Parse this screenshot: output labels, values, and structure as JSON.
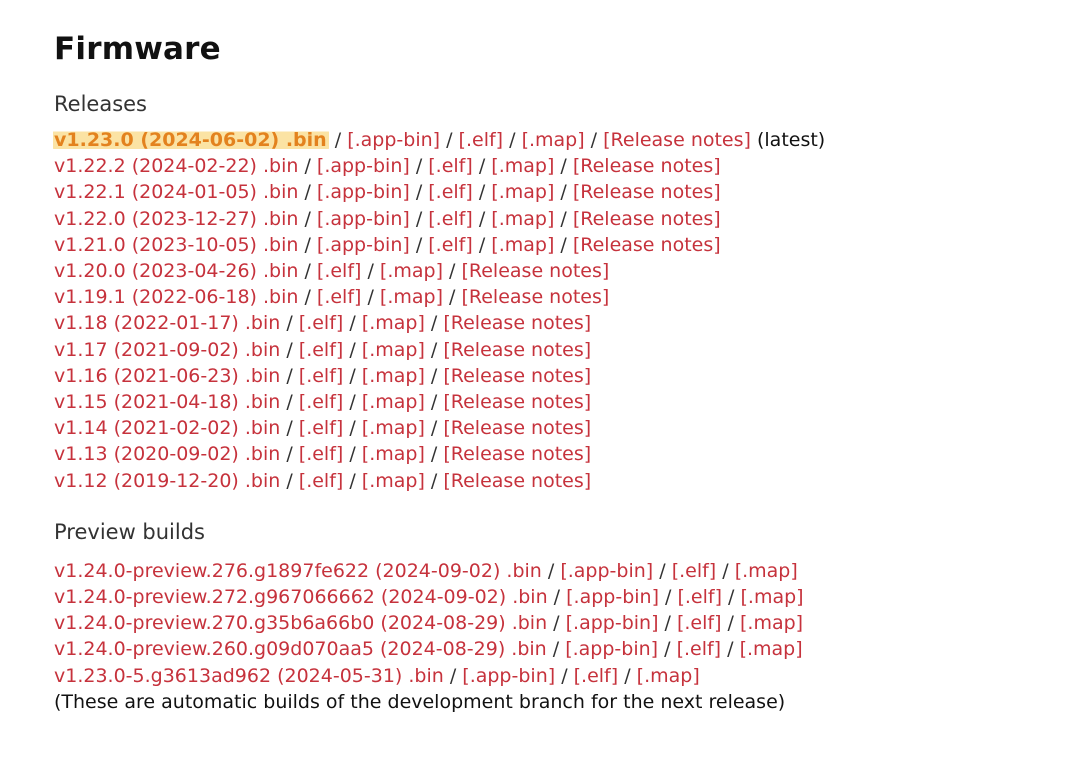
{
  "title": "Firmware",
  "releases_heading": "Releases",
  "releases": [
    {
      "bin": "v1.23.0 (2024-06-02) .bin",
      "app_bin": "[.app-bin]",
      "elf": "[.elf]",
      "map": "[.map]",
      "notes": "[Release notes]",
      "tag": "(latest)"
    },
    {
      "bin": "v1.22.2 (2024-02-22) .bin",
      "app_bin": "[.app-bin]",
      "elf": "[.elf]",
      "map": "[.map]",
      "notes": "[Release notes]"
    },
    {
      "bin": "v1.22.1 (2024-01-05) .bin",
      "app_bin": "[.app-bin]",
      "elf": "[.elf]",
      "map": "[.map]",
      "notes": "[Release notes]"
    },
    {
      "bin": "v1.22.0 (2023-12-27) .bin",
      "app_bin": "[.app-bin]",
      "elf": "[.elf]",
      "map": "[.map]",
      "notes": "[Release notes]"
    },
    {
      "bin": "v1.21.0 (2023-10-05) .bin",
      "app_bin": "[.app-bin]",
      "elf": "[.elf]",
      "map": "[.map]",
      "notes": "[Release notes]"
    },
    {
      "bin": "v1.20.0 (2023-04-26) .bin",
      "elf": "[.elf]",
      "map": "[.map]",
      "notes": "[Release notes]"
    },
    {
      "bin": "v1.19.1 (2022-06-18) .bin",
      "elf": "[.elf]",
      "map": "[.map]",
      "notes": "[Release notes]"
    },
    {
      "bin": "v1.18 (2022-01-17) .bin",
      "elf": "[.elf]",
      "map": "[.map]",
      "notes": "[Release notes]"
    },
    {
      "bin": "v1.17 (2021-09-02) .bin",
      "elf": "[.elf]",
      "map": "[.map]",
      "notes": "[Release notes]"
    },
    {
      "bin": "v1.16 (2021-06-23) .bin",
      "elf": "[.elf]",
      "map": "[.map]",
      "notes": "[Release notes]"
    },
    {
      "bin": "v1.15 (2021-04-18) .bin",
      "elf": "[.elf]",
      "map": "[.map]",
      "notes": "[Release notes]"
    },
    {
      "bin": "v1.14 (2021-02-02) .bin",
      "elf": "[.elf]",
      "map": "[.map]",
      "notes": "[Release notes]"
    },
    {
      "bin": "v1.13 (2020-09-02) .bin",
      "elf": "[.elf]",
      "map": "[.map]",
      "notes": "[Release notes]"
    },
    {
      "bin": "v1.12 (2019-12-20) .bin",
      "elf": "[.elf]",
      "map": "[.map]",
      "notes": "[Release notes]"
    }
  ],
  "preview_heading": "Preview builds",
  "previews": [
    {
      "bin": "v1.24.0-preview.276.g1897fe622 (2024-09-02) .bin",
      "app_bin": "[.app-bin]",
      "elf": "[.elf]",
      "map": "[.map]"
    },
    {
      "bin": "v1.24.0-preview.272.g967066662 (2024-09-02) .bin",
      "app_bin": "[.app-bin]",
      "elf": "[.elf]",
      "map": "[.map]"
    },
    {
      "bin": "v1.24.0-preview.270.g35b6a66b0 (2024-08-29) .bin",
      "app_bin": "[.app-bin]",
      "elf": "[.elf]",
      "map": "[.map]"
    },
    {
      "bin": "v1.24.0-preview.260.g09d070aa5 (2024-08-29) .bin",
      "app_bin": "[.app-bin]",
      "elf": "[.elf]",
      "map": "[.map]"
    },
    {
      "bin": "v1.23.0-5.g3613ad962 (2024-05-31) .bin",
      "app_bin": "[.app-bin]",
      "elf": "[.elf]",
      "map": "[.map]"
    }
  ],
  "preview_note": "(These are automatic builds of the development branch for the next release)",
  "separator": " / ",
  "colors": {
    "link": "#c6323c",
    "highlight_text": "#e3821e",
    "highlight_background": "#fbe3a4",
    "text": "#111111"
  }
}
